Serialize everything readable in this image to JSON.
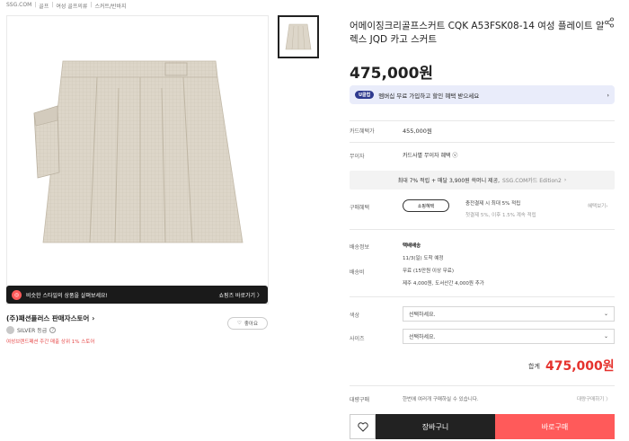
{
  "breadcrumb": [
    "SSG.COM",
    "골프",
    "여성 골프의류",
    "스커트/반바지"
  ],
  "similar_banner": {
    "text": "비슷한 스타일의 상품을 살펴보세요!",
    "link": "쇼핑즈 바로가기 〉"
  },
  "store": {
    "name": "(주)패션플러스 판매자스토어",
    "grade": "SILVER 등급",
    "note": "여성브랜드패션 주간 매출 상위 1% 스토어",
    "like_label": "좋아요"
  },
  "product": {
    "title": "어메이징크리골프스커트 CQK A53FSK08-14 여성 플레이트 알렉스 JQD 카고 스커트",
    "price": "475,000원"
  },
  "member_banner": {
    "badge": "U클럽",
    "text": "멤버십 무료 가입하고 할인 혜택 받으세요"
  },
  "rows": {
    "card_price_label": "카드혜택가",
    "card_price_value": "455,000원",
    "interest_label": "무이자",
    "interest_value": "카드사별 무이자 혜택",
    "benefit_text": "최대 7% 적립 + 매달 3,900원 쓱머니 제공,",
    "benefit_link": "SSG.COM카드 Edition2",
    "purchase_label": "구매혜택",
    "purchase_pill": "쇼핑혜택",
    "purchase_desc": "충전결제 시 최대 5% 적립",
    "purchase_sub": "첫결제 5%, 이후 1.5% 계속 적립",
    "purchase_more": "혜택보기",
    "delivery_info_label": "배송정보",
    "delivery_type": "택배배송",
    "delivery_date": "11/3(일) 도착 예정",
    "delivery_fee_label": "배송비",
    "delivery_fee": "무료 (15만원 이상 무료)",
    "delivery_extra": "제주 4,000원, 도서산간 4,000원 추가"
  },
  "options": {
    "color_label": "색상",
    "color_placeholder": "선택하세요.",
    "size_label": "사이즈",
    "size_placeholder": "선택하세요."
  },
  "total": {
    "label": "합계",
    "price": "475,000원"
  },
  "bulk": {
    "label": "대량구매",
    "text": "한번에 여러개 구매하실 수 있습니다.",
    "link": "대량구매하기 〉"
  },
  "actions": {
    "cart": "장바구니",
    "buy": "바로구매"
  },
  "colors": {
    "accent_red": "#e5322d",
    "buy_button": "#ff5a5a",
    "member_bg": "#e9ecfa",
    "skirt": "#ddd6c9"
  }
}
